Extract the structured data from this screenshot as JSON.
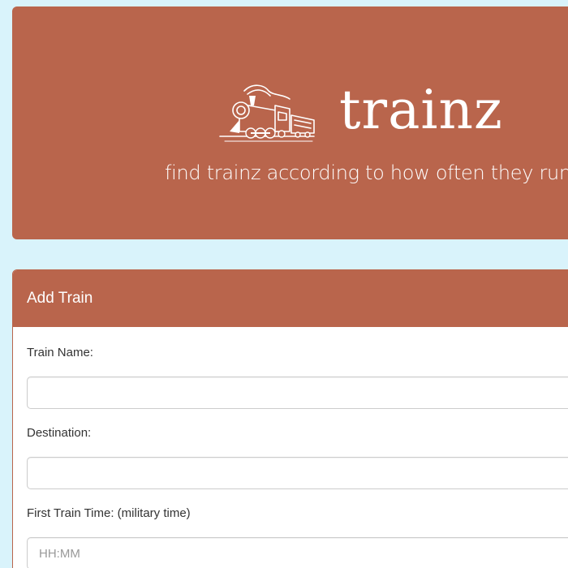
{
  "header": {
    "title": "trainz",
    "subtitle": "find trainz according to how often they run",
    "logo_icon": "steam-locomotive-icon"
  },
  "add_train_panel": {
    "heading": "Add Train",
    "fields": [
      {
        "label": "Train Name:",
        "value": "",
        "placeholder": ""
      },
      {
        "label": "Destination:",
        "value": "",
        "placeholder": ""
      },
      {
        "label": "First Train Time: (military time)",
        "value": "",
        "placeholder": "HH:MM"
      }
    ]
  },
  "colors": {
    "page_background": "#d9f3fb",
    "accent": "#b9654c",
    "panel_background": "#ffffff"
  }
}
